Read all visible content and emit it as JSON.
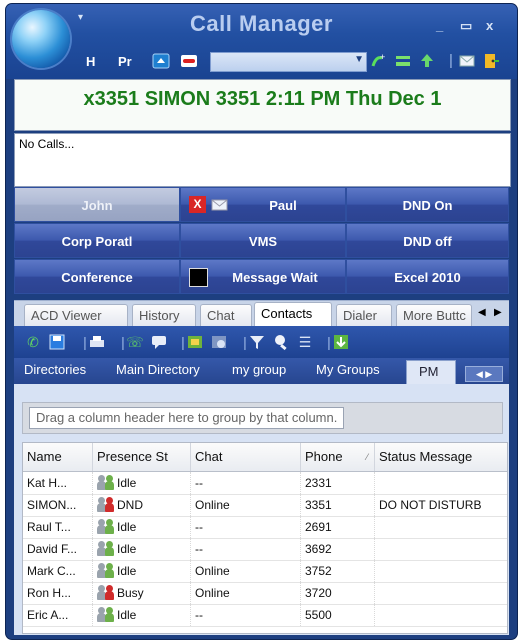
{
  "window": {
    "title": "Call Manager"
  },
  "toolbar": {
    "quick_access_arrow": "▾",
    "h_label": "H",
    "pr_label": "Pr",
    "dial_value": "",
    "icons": [
      "phone-icon",
      "hangup-icon",
      "add-contact-icon",
      "voicemail-icon",
      "transfer-icon",
      "mail-icon",
      "exit-icon"
    ]
  },
  "window_controls": {
    "minimize": "_",
    "maximize": "▭",
    "close": "x"
  },
  "banner": {
    "text": "x3351 SIMON 3351 2:11 PM Thu Dec 1",
    "color": "#1b7c1b"
  },
  "calls": {
    "text": "No Calls..."
  },
  "buttons": {
    "row1": [
      "John",
      "Paul",
      "DND On"
    ],
    "row2": [
      "Corp Poratl",
      "VMS",
      "DND off"
    ],
    "row3": [
      "Conference",
      "Message Wait",
      "Excel 2010"
    ]
  },
  "tabs": [
    {
      "label": "ACD Viewer",
      "active": false
    },
    {
      "label": "History",
      "active": false
    },
    {
      "label": "Chat",
      "active": false
    },
    {
      "label": "Contacts",
      "active": true
    },
    {
      "label": "Dialer",
      "active": false
    },
    {
      "label": "More Buttc",
      "active": false
    }
  ],
  "subtabs": [
    {
      "label": "Directories",
      "active": false
    },
    {
      "label": "Main Directory",
      "active": false
    },
    {
      "label": "my group",
      "active": false
    },
    {
      "label": "My Groups",
      "active": false
    },
    {
      "label": "PM",
      "active": true
    }
  ],
  "group_hint": "Drag a column header here to group by that column.",
  "table": {
    "columns": [
      "Name",
      "Presence St",
      "Chat",
      "Phone",
      "Status Message"
    ],
    "rows": [
      {
        "name": "Kat H...",
        "presence": "Idle",
        "presence_color": "#6db04a",
        "chat": "--",
        "phone": "2331",
        "status": ""
      },
      {
        "name": "SIMON...",
        "presence": "DND",
        "presence_color": "#d02b2b",
        "chat": "Online",
        "phone": "3351",
        "status": "DO NOT DISTURB"
      },
      {
        "name": "Raul T...",
        "presence": "Idle",
        "presence_color": "#6db04a",
        "chat": "--",
        "phone": "2691",
        "status": ""
      },
      {
        "name": "David F...",
        "presence": "Idle",
        "presence_color": "#6db04a",
        "chat": "--",
        "phone": "3692",
        "status": ""
      },
      {
        "name": "Mark C...",
        "presence": "Idle",
        "presence_color": "#6db04a",
        "chat": "Online",
        "phone": "3752",
        "status": ""
      },
      {
        "name": "Ron H...",
        "presence": "Busy",
        "presence_color": "#d02b2b",
        "chat": "Online",
        "phone": "3720",
        "status": ""
      },
      {
        "name": "Eric A...",
        "presence": "Idle",
        "presence_color": "#6db04a",
        "chat": "--",
        "phone": "5500",
        "status": ""
      }
    ]
  }
}
